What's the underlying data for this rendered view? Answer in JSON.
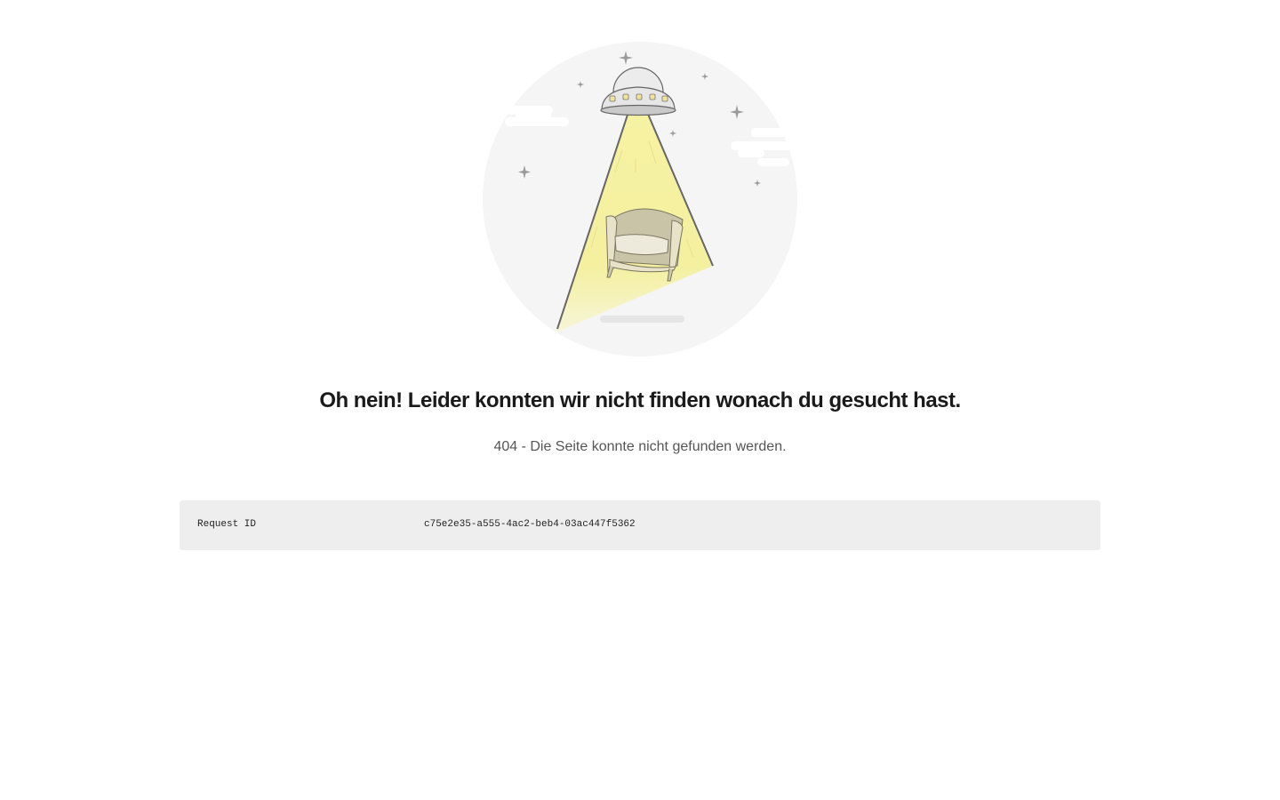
{
  "error": {
    "headline": "Oh nein! Leider konnten wir nicht finden wonach du gesucht hast.",
    "message": "404 - Die Seite konnte nicht gefunden werden."
  },
  "request": {
    "label": "Request ID",
    "value": "c75e2e35-a555-4ac2-beb4-03ac447f5362"
  },
  "illustration": {
    "icons": [
      "ufo-icon",
      "armchair-icon",
      "star-icon",
      "cloud-icon"
    ],
    "colors": {
      "circle": "#f5f5f5",
      "beam": "#f6f2a3",
      "ufo": "#e6e6e6",
      "ufo_lights": "#f1e39a",
      "armchair": "#e8e3c8"
    }
  },
  "colors": {
    "headline": "#1a1a1a",
    "message": "#555555",
    "info_box": "#eeeeee"
  }
}
